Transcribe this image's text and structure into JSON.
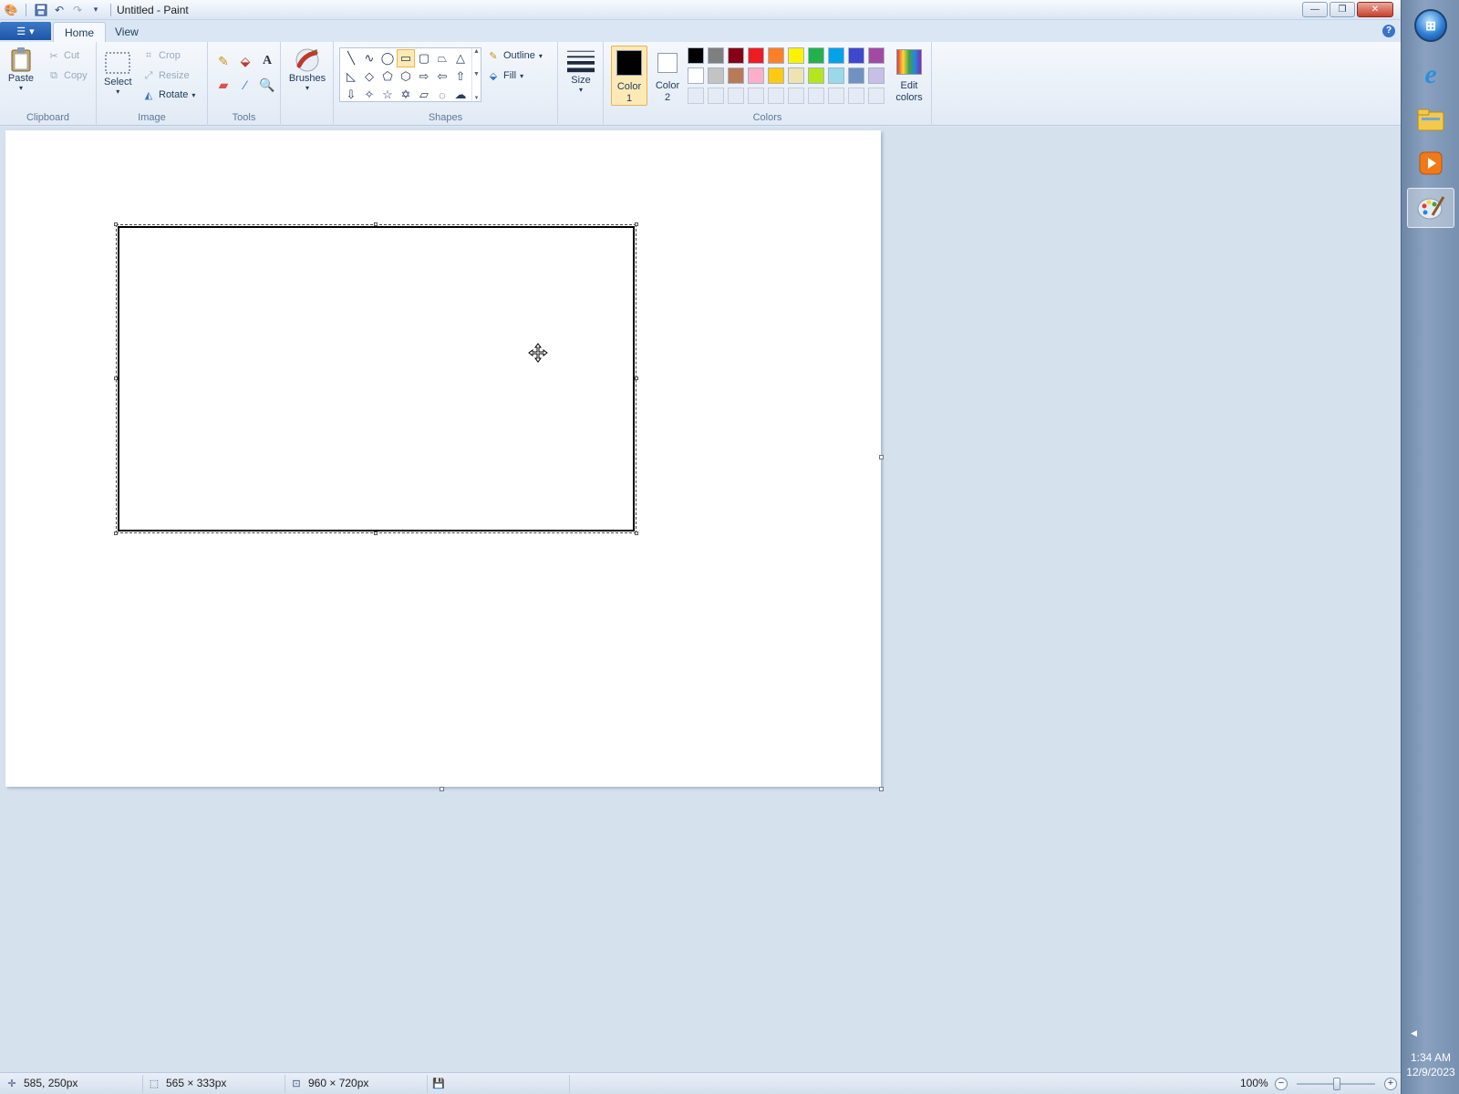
{
  "window": {
    "title": "Untitled - Paint",
    "controls": {
      "minimize": "—",
      "restore": "❐",
      "close": "✕"
    }
  },
  "quick_access": [
    "save-icon",
    "undo-icon",
    "redo-icon",
    "customize-arrow-icon"
  ],
  "tabs": [
    {
      "label": "Home",
      "active": true
    },
    {
      "label": "View",
      "active": false
    }
  ],
  "ribbon": {
    "clipboard": {
      "label": "Clipboard",
      "paste": "Paste",
      "cut": "Cut",
      "copy": "Copy"
    },
    "image": {
      "label": "Image",
      "select": "Select",
      "crop": "Crop",
      "resize": "Resize",
      "rotate": "Rotate"
    },
    "tools": {
      "label": "Tools",
      "items": [
        "pencil-icon",
        "fill-icon",
        "text-icon",
        "eraser-icon",
        "color-picker-icon",
        "magnifier-icon"
      ]
    },
    "brushes": {
      "label": "Brushes"
    },
    "shapes": {
      "label": "Shapes",
      "outline": "Outline",
      "fill": "Fill",
      "selected": "rectangle"
    },
    "size": {
      "label": "Size"
    },
    "colors": {
      "label": "Colors",
      "color1": {
        "line1": "Color",
        "line2": "1",
        "value": "#000000"
      },
      "color2": {
        "line1": "Color",
        "line2": "2",
        "value": "#ffffff"
      },
      "edit": {
        "line1": "Edit",
        "line2": "colors"
      },
      "palette_row1": [
        "#000000",
        "#7f7f7f",
        "#880015",
        "#ed1c24",
        "#ff7f27",
        "#fff200",
        "#22b14c",
        "#00a2e8",
        "#3f48cc",
        "#a349a4"
      ],
      "palette_row2": [
        "#ffffff",
        "#c3c3c3",
        "#b97a57",
        "#ffaec9",
        "#ffc90e",
        "#efe4b0",
        "#b5e61d",
        "#99d9ea",
        "#7092be",
        "#c8bfe7"
      ]
    }
  },
  "status": {
    "cursor_pos": "585, 250px",
    "selection_size": "565 × 333px",
    "image_size": "960 × 720px",
    "zoom": "100%",
    "zoom_out": "−",
    "zoom_in": "+"
  },
  "taskbar": {
    "time": "1:34 AM",
    "date": "12/9/2023",
    "pinned": [
      "internet-explorer-icon",
      "windows-explorer-icon",
      "media-player-icon",
      "paint-icon"
    ]
  }
}
